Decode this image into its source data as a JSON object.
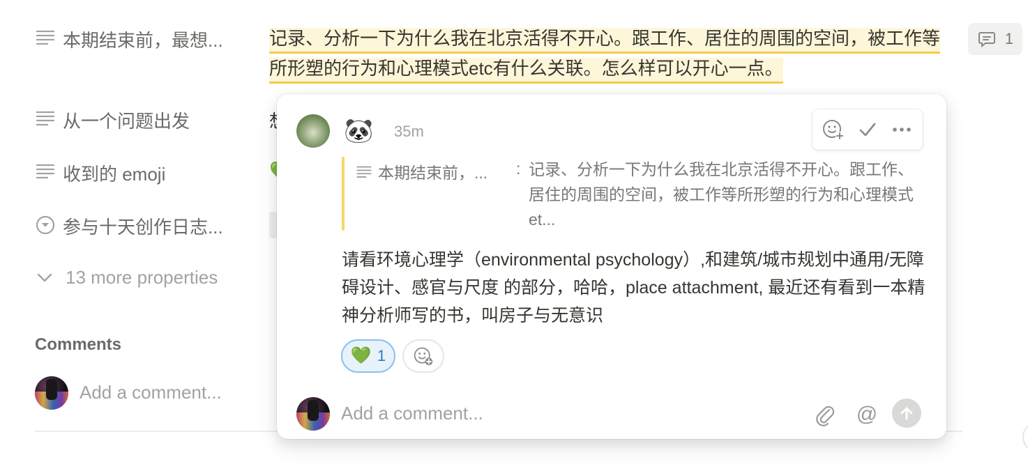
{
  "properties": {
    "row1": {
      "name": "本期结束前，最想...",
      "value": "记录、分析一下为什么我在北京活得不开心。跟工作、居住的周围的空间，被工作等所形塑的行为和心理模式etc有什么关联。怎么样可以开心一点。",
      "icon": "text-lines-icon",
      "comment_count": "1"
    },
    "row2": {
      "name": "从一个问题出发",
      "value": "想",
      "icon": "text-lines-icon"
    },
    "row3": {
      "name": "收到的 emoji",
      "value": "💚",
      "icon": "text-lines-icon"
    },
    "row4": {
      "name": "参与十天创作日志...",
      "icon": "select-circle-icon"
    },
    "more": {
      "label": "13 more properties",
      "icon": "chevron-down-icon"
    }
  },
  "comments_section": {
    "heading": "Comments",
    "placeholder": "Add a comment..."
  },
  "comment_popup": {
    "author_emoji": "🐼",
    "time": "35m",
    "quote": {
      "property": "本期结束前，...",
      "separator": ":",
      "text": "记录、分析一下为什么我在北京活得不开心。跟工作、居住的周围的空间，被工作等所形塑的行为和心理模式et..."
    },
    "body": "请看环境心理学（environmental psychology）,和建筑/城市规划中通用/无障碍设计、感官与尺度 的部分，哈哈，place attachment, 最近还有看到一本精神分析师写的书，叫房子与无意识",
    "reaction": {
      "emoji": "💚",
      "count": "1"
    },
    "reply_placeholder": "Add a comment...",
    "mention_symbol": "@",
    "actions": [
      "add-reaction-icon",
      "resolve-check-icon",
      "more-horizontal-icon"
    ]
  },
  "colors": {
    "highlight_bg": "#fdf6d9",
    "highlight_underline": "#f3cd46",
    "quote_bar": "#f3d866",
    "reaction_border": "#8ac0ee",
    "reaction_bg": "#e8f2fb",
    "text_primary": "#37352f",
    "text_secondary": "#787774"
  }
}
